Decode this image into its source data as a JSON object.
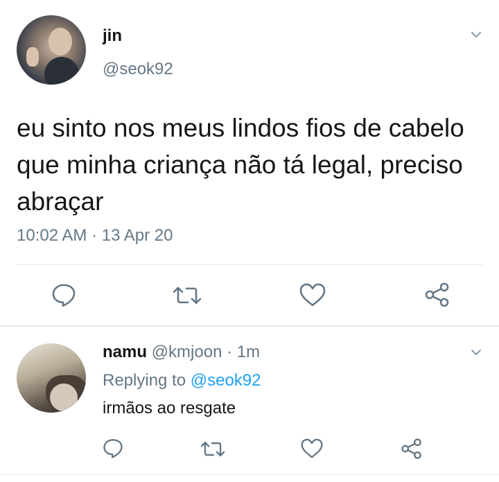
{
  "tweet": {
    "display_name": "jin",
    "handle": "@seok92",
    "text": "eu sinto nos meus lindos fios de cabelo que minha criança não tá legal, preciso abraçar",
    "timestamp": "10:02 AM · 13 Apr 20"
  },
  "reply": {
    "display_name": "namu",
    "handle": "@kmjoon",
    "time": "· 1m",
    "replying_prefix": "Replying to",
    "replying_mention": "@seok92",
    "text": "irmãos ao resgate"
  },
  "icons": {
    "reply": "reply-icon",
    "retweet": "retweet-icon",
    "like": "heart-icon",
    "share": "share-icon",
    "menu": "chevron-down-icon"
  },
  "colors": {
    "text": "#14171a",
    "secondary": "#657786",
    "link": "#1da1f2",
    "divider": "#e1e8ed"
  }
}
